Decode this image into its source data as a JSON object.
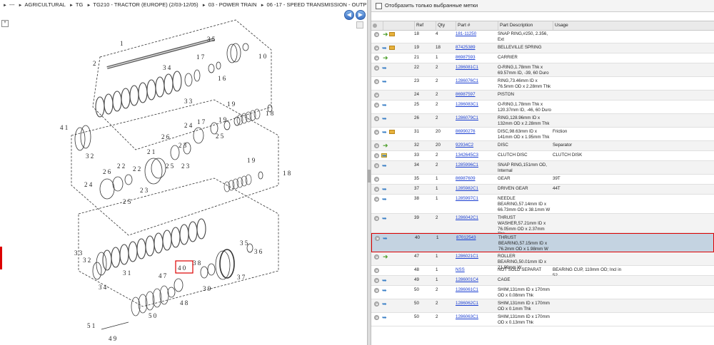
{
  "breadcrumb": [
    "---",
    "AGRICULTURAL",
    "TG",
    "TG210 - TRACTOR (EUROPE) (2/03-12/05)",
    "03 - POWER TRAIN",
    "06 -17 - SPEED TRANSMISSION - OUTPUT ..."
  ],
  "filter_label": "Отобразить только выбранные метки",
  "columns": {
    "ref": "Ref",
    "qty": "Qty",
    "part": "Part #",
    "desc": "Part Description",
    "usage": "Usage"
  },
  "icons": {
    "nav_back": "arrow-left-icon",
    "nav_fwd": "arrow-right-icon",
    "info": "info-circle-icon",
    "related": "blue-arrow-icon",
    "add": "green-arrow-icon",
    "package": "package-icon"
  },
  "colors": {
    "link": "#1a3ed1",
    "selected_row": "#c4d3e1",
    "highlight_border": "#dd0000"
  },
  "rows": [
    {
      "ref": "18",
      "qty": "4",
      "part": "181-11250",
      "desc": "SNAP RING,#250, 2.356, Ext",
      "usage": "",
      "icons": [
        "green",
        "pkg"
      ]
    },
    {
      "ref": "19",
      "qty": "18",
      "part": "87425389",
      "desc": "BELLEVILLE SPRING",
      "usage": "",
      "icons": [
        "blue",
        "pkg"
      ]
    },
    {
      "ref": "21",
      "qty": "1",
      "part": "86987593",
      "desc": "CARRIER",
      "usage": "",
      "icons": [
        "green"
      ]
    },
    {
      "ref": "22",
      "qty": "2",
      "part": "1286081C1",
      "desc": "O-RING,1.78mm Thk x 69.57mm ID, -39, 60 Duro",
      "usage": "",
      "icons": [
        "blue"
      ]
    },
    {
      "ref": "23",
      "qty": "2",
      "part": "1286076C1",
      "desc": "RING,73.46mm ID x 76.5mm OD x 2.28mm Thk",
      "usage": "",
      "icons": [
        "blue"
      ]
    },
    {
      "ref": "24",
      "qty": "2",
      "part": "86987597",
      "desc": "PISTON",
      "usage": "",
      "icons": []
    },
    {
      "ref": "25",
      "qty": "2",
      "part": "1286083C1",
      "desc": "O-RING,1.78mm Thk x 120.37mm ID, -46, 60 Duro",
      "usage": "",
      "icons": [
        "blue"
      ]
    },
    {
      "ref": "26",
      "qty": "2",
      "part": "1286079C1",
      "desc": "RING,128.96mm ID x 132mm OD x 2.28mm Thk",
      "usage": "",
      "icons": [
        "blue"
      ]
    },
    {
      "ref": "31",
      "qty": "20",
      "part": "86990276",
      "desc": "DISC,98.63mm ID x 141mm OD x 1.95mm Thk",
      "usage": "Friction",
      "icons": [
        "blue",
        "pkg"
      ]
    },
    {
      "ref": "32",
      "qty": "20",
      "part": "92934C2",
      "desc": "DISC",
      "usage": "Separator",
      "icons": [
        "green"
      ]
    },
    {
      "ref": "33",
      "qty": "2",
      "part": "1342645C3",
      "desc": "CLUTCH DISC",
      "usage": "CLUTCH DISK",
      "icons": [
        "fold",
        "blue"
      ]
    },
    {
      "ref": "34",
      "qty": "2",
      "part": "1285996C1",
      "desc": "SNAP RING,151mm OD, Internal",
      "usage": "",
      "icons": [
        "blue"
      ]
    },
    {
      "ref": "35",
      "qty": "1",
      "part": "86987609",
      "desc": "GEAR",
      "usage": "39T",
      "icons": []
    },
    {
      "ref": "37",
      "qty": "1",
      "part": "1285982C1",
      "desc": "DRIVEN GEAR",
      "usage": "44T",
      "icons": [
        "blue"
      ]
    },
    {
      "ref": "38",
      "qty": "1",
      "part": "1285997C1",
      "desc": "NEEDLE BEARING,57.14mm ID x 66.73mm OD x 38.1mm W",
      "usage": "",
      "icons": [
        "blue"
      ]
    },
    {
      "ref": "39",
      "qty": "2",
      "part": "1286042C1",
      "desc": "THRUST WASHER,57.21mm ID x 76.05mm OD x 2.37mm Thk",
      "usage": "",
      "icons": [
        "blue"
      ]
    },
    {
      "ref": "40",
      "qty": "1",
      "part": "87012543",
      "desc": "THRUST BEARING,57.15mm ID x 76.2mm OD x 1.98mm W",
      "usage": "",
      "icons": [
        "blue"
      ]
    },
    {
      "ref": "47",
      "qty": "1",
      "part": "1286021C1",
      "desc": "ROLLER BEARING,50.01mm ID x 21.99mm W",
      "usage": "",
      "icons": [
        "green"
      ]
    },
    {
      "ref": "48",
      "qty": "1",
      "part": "NSS",
      "desc": "NOT SOLD SEPARAT",
      "usage": "BEARING CUP, 110mm OD; Incl in 52",
      "icons": []
    },
    {
      "ref": "49",
      "qty": "1",
      "part": "1286001C4",
      "desc": "CAGE",
      "usage": "",
      "icons": [
        "blue"
      ]
    },
    {
      "ref": "50",
      "qty": "2",
      "part": "1286061C1",
      "desc": "SHIM,131mm ID x 170mm OD x 0.08mm Thk",
      "usage": "",
      "icons": [
        "blue"
      ]
    },
    {
      "ref": "50",
      "qty": "2",
      "part": "1286062C1",
      "desc": "SHIM,131mm ID x 170mm OD x 0.1mm Thk",
      "usage": "",
      "icons": [
        "blue"
      ]
    },
    {
      "ref": "50",
      "qty": "2",
      "part": "1286063C1",
      "desc": "SHIM,131mm ID x 170mm OD x 0.13mm Thk",
      "usage": "",
      "icons": [
        "blue"
      ]
    }
  ],
  "diagram_labels": {
    "l1": "1",
    "l2": "2",
    "l35": "3 5",
    "l10": "1 0",
    "l16": "1 6",
    "l17": "1 7",
    "l34": "3 4",
    "l33": "3 3",
    "l19a": "1 9",
    "l18a": "1 8",
    "l24a": "2 4",
    "l25a": "2 5",
    "l26a": "2 6",
    "l23a": "2 3",
    "l41": "4 1",
    "l32a": "3 2",
    "l21": "2 1",
    "l22a": "2 2",
    "l26b": "2 6",
    "l24b": "2 4",
    "l22b": "2 2",
    "l25b": "2 5",
    "l23b": "2 3",
    "l19b": "1 9",
    "l18b": "1 8",
    "l33b": "3 3",
    "l32b": "3 2",
    "l31": "3 1",
    "l34b": "3 4",
    "l40": "4 0",
    "l47": "4 7",
    "l38": "3 8",
    "l39": "3 9",
    "l37": "3 7",
    "l36": "3 6",
    "l48": "4 8",
    "l51": "5 1",
    "l49": "4 9",
    "l50": "5 0"
  }
}
